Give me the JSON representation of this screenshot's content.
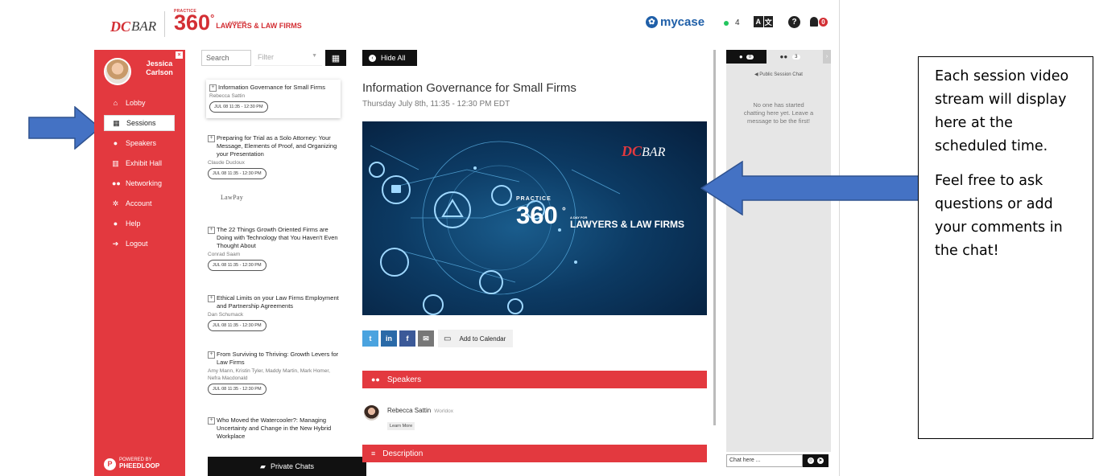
{
  "header": {
    "brand_dc": "DC",
    "brand_bar": "BAR",
    "event_small": "PRACTICE",
    "event_big": "360",
    "event_degree": "°",
    "event_tag_small": "A DAY FOR",
    "event_tag": "LAWYERS & LAW FIRMS",
    "sponsor": "mycase",
    "online_count": "4",
    "translate_label_a": "A",
    "translate_label_b": "文",
    "help_glyph": "?",
    "notification_count": "0"
  },
  "sidebar": {
    "user_name": "Jessica Carlson",
    "items": [
      {
        "label": "Lobby",
        "icon": "home-icon"
      },
      {
        "label": "Sessions",
        "icon": "calendar-icon"
      },
      {
        "label": "Speakers",
        "icon": "user-icon"
      },
      {
        "label": "Exhibit Hall",
        "icon": "columns-icon"
      },
      {
        "label": "Networking",
        "icon": "users-icon"
      },
      {
        "label": "Account",
        "icon": "gear-icon"
      },
      {
        "label": "Help",
        "icon": "info-icon"
      },
      {
        "label": "Logout",
        "icon": "logout-icon"
      }
    ],
    "powered_by": "POWERED BY",
    "powered_brand": "PHEEDLOOP"
  },
  "session_list": {
    "search_placeholder": "Search",
    "filter_placeholder": "Filter",
    "sessions": [
      {
        "title": "Information Governance for Small Firms",
        "speakers": "Rebecca Sattin",
        "time": "JUL 08 11:35 - 12:30 PM"
      },
      {
        "title": "Preparing for Trial as a Solo Attorney: Your Message, Elements of Proof, and Organizing your Presentation",
        "speakers": "Claude Ducloux",
        "time": "JUL 08 11:35 - 12:30 PM"
      },
      {
        "title": "The 22 Things Growth Oriented Firms are Doing with Technology that You Haven't Even Thought About",
        "speakers": "Conrad Saam",
        "time": "JUL 08 11:35 - 12:30 PM"
      },
      {
        "title": "Ethical Limits on your Law Firms Employment and Partnership Agreements",
        "speakers": "Dan Schumack",
        "time": "JUL 08 11:35 - 12:30 PM"
      },
      {
        "title": "From Surviving to Thriving: Growth Levers for Law Firms",
        "speakers": "Amy Mann, Kristin Tyler, Maddy Martin, Mark Homer, Nefra Macdonald",
        "time": "JUL 08 11:35 - 12:30 PM"
      },
      {
        "title": "Who Moved the Watercooler?: Managing Uncertainty and Change in the New Hybrid Workplace",
        "speakers": "",
        "time": ""
      }
    ],
    "sponsor_logo_text": "LawPay",
    "private_chats": "Private Chats"
  },
  "main": {
    "hide_all": "Hide All",
    "title": "Information Governance for Small Firms",
    "date": "Thursday July 8th, 11:35 - 12:30 PM EDT",
    "video": {
      "brand_dc": "DC",
      "brand_bar": "BAR",
      "practice": "PRACTICE",
      "big": "360",
      "degree": "°",
      "day_for": "A DAY FOR",
      "tagline": "LAWYERS & LAW FIRMS"
    },
    "share": {
      "twitter": "t",
      "linkedin": "in",
      "facebook": "f",
      "email": "✉"
    },
    "add_to_calendar": "Add to Calendar",
    "speakers_heading": "Speakers",
    "speaker": {
      "name": "Rebecca Sattin",
      "company": "Worldox",
      "learn_more": "Learn More"
    },
    "description_heading": "Description"
  },
  "chat": {
    "tab_chat_count": "0",
    "tab_people_count": "3",
    "title": "Public Session Chat",
    "empty_message": "No one has started chatting here yet. Leave a message to be the first!",
    "input_placeholder": "Chat here ..."
  },
  "callout": {
    "line1": "Each session video stream will display here at the scheduled time.",
    "line2": "Feel free to ask questions or add your comments in the chat!"
  },
  "colors": {
    "accent": "#e3393f",
    "arrow": "#4472c4",
    "dark": "#111111"
  }
}
